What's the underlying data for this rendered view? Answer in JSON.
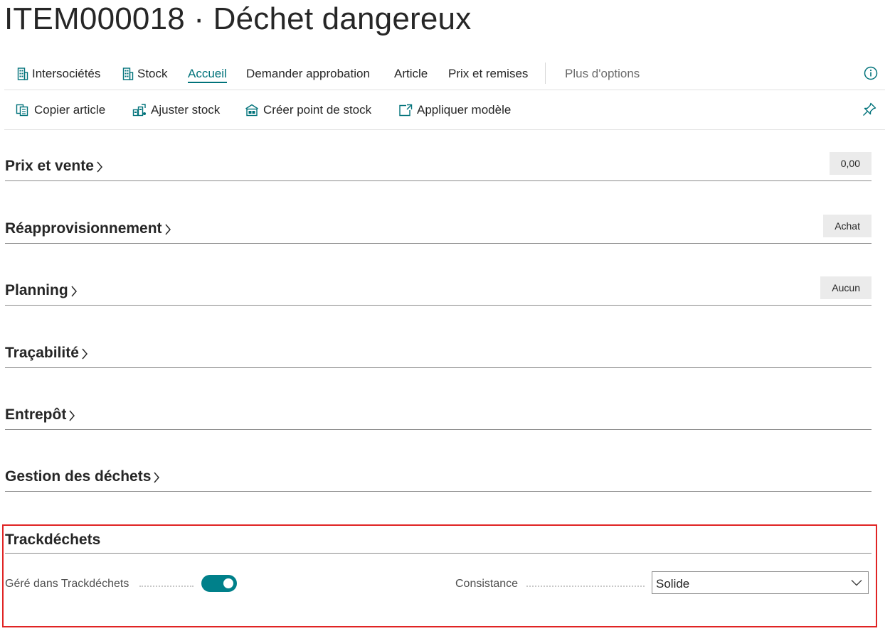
{
  "page": {
    "title": "ITEM000018 · Déchet dangereux"
  },
  "action_bar": {
    "items": [
      {
        "label": "Intersociétés",
        "icon": "building-icon"
      },
      {
        "label": "Stock",
        "icon": "building-icon"
      },
      {
        "label": "Accueil",
        "active": true
      },
      {
        "label": "Demander approbation"
      },
      {
        "label": "Article"
      },
      {
        "label": "Prix et remises"
      }
    ],
    "more_label": "Plus d'options",
    "info_icon": "info-icon"
  },
  "sub_actions": {
    "items": [
      {
        "label": "Copier article",
        "icon": "copy-icon"
      },
      {
        "label": "Ajuster stock",
        "icon": "adjust-stock-icon"
      },
      {
        "label": "Créer point de stock",
        "icon": "create-stockkeeping-icon"
      },
      {
        "label": "Appliquer modèle",
        "icon": "apply-template-icon"
      }
    ],
    "pin_icon": "pin-icon"
  },
  "sections": [
    {
      "title": "Prix et vente",
      "value": "0,00"
    },
    {
      "title": "Réapprovisionnement",
      "value": "Achat"
    },
    {
      "title": "Planning",
      "value": "Aucun"
    },
    {
      "title": "Traçabilité"
    },
    {
      "title": "Entrepôt"
    },
    {
      "title": "Gestion des déchets"
    }
  ],
  "trackdechets": {
    "title": "Trackdéchets",
    "managed_label": "Géré dans Trackdéchets",
    "managed_on": true,
    "consistency_label": "Consistance",
    "consistency_value": "Solide"
  },
  "colors": {
    "accent": "#00727a",
    "toggle": "#00808a",
    "highlight_border": "#e02424"
  }
}
